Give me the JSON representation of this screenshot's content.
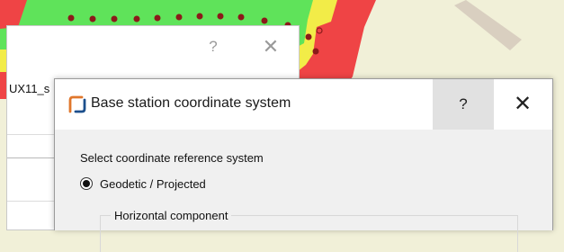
{
  "background_dialog": {
    "help_label": "?",
    "close_label": "✕",
    "field_label": "UX11_s"
  },
  "dialog": {
    "title": "Base station coordinate system",
    "help_label": "?",
    "close_label": "✕",
    "prompt": "Select coordinate reference system",
    "option_selected": "Geodetic / Projected",
    "group_title": "Horizontal component"
  },
  "colors": {
    "coverage_high": "#5fe35a",
    "coverage_mid": "#f2ec48",
    "coverage_low": "#ef4445",
    "map_background": "#f1f0d8",
    "marker_dot": "#8b1a1a",
    "app_icon_accent": "#e0772c"
  },
  "icons": {
    "app": "orange-bracket-icon",
    "help": "question-mark-icon",
    "close": "close-icon",
    "radio": "radio-selected-icon"
  }
}
